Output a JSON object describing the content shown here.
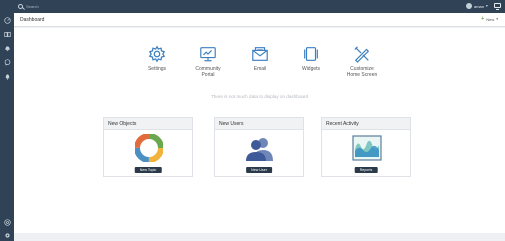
{
  "topbar": {
    "search_placeholder": "Search",
    "user_name": "aman",
    "user_caret": "▾"
  },
  "sidebar": {
    "icons": [
      "dashboard-icon",
      "cards-icon",
      "bell-icon",
      "chat-icon",
      "notification-icon",
      "help-icon",
      "settings-icon"
    ]
  },
  "header": {
    "title": "Dashboard",
    "new_plus": "+",
    "new_label": "New",
    "new_caret": "▾"
  },
  "quick_actions": [
    {
      "label": "Settings",
      "icon": "gear-icon"
    },
    {
      "label": "Community\nPortal",
      "icon": "monitor-icon"
    },
    {
      "label": "Email",
      "icon": "envelope-icon"
    },
    {
      "label": "Widgets",
      "icon": "widgets-icon"
    },
    {
      "label": "Customize\nHome Screen",
      "icon": "customize-icon"
    }
  ],
  "empty_message": "There is not much data to display on dashboard",
  "cards": [
    {
      "title": "New Objects",
      "button": "New Topic",
      "icon": "pie-icon"
    },
    {
      "title": "New Users",
      "button": "New User",
      "icon": "users-icon"
    },
    {
      "title": "Recent Activity",
      "button": "Reports",
      "icon": "activity-chart-icon"
    }
  ],
  "colors": {
    "nav_bg": "#2f4256",
    "accent_green": "#5aa33a",
    "icon_blue": "#3c7fc0",
    "button_dark": "#2b3a4a"
  }
}
